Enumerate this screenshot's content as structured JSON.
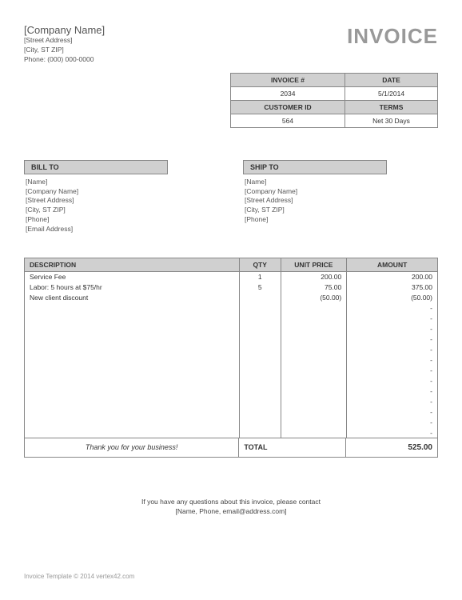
{
  "company": {
    "name": "[Company Name]",
    "street": "[Street Address]",
    "city": "[City, ST  ZIP]",
    "phone": "Phone: (000) 000-0000"
  },
  "title": "INVOICE",
  "meta": {
    "invoice_h": "INVOICE #",
    "invoice_v": "2034",
    "date_h": "DATE",
    "date_v": "5/1/2014",
    "cust_h": "CUSTOMER ID",
    "cust_v": "564",
    "terms_h": "TERMS",
    "terms_v": "Net 30 Days"
  },
  "billto": {
    "h": "BILL TO",
    "lines": [
      "[Name]",
      "[Company Name]",
      "[Street Address]",
      "[City, ST  ZIP]",
      "[Phone]",
      "[Email Address]"
    ]
  },
  "shipto": {
    "h": "SHIP TO",
    "lines": [
      "[Name]",
      "[Company Name]",
      "[Street Address]",
      "[City, ST  ZIP]",
      "[Phone]"
    ]
  },
  "cols": {
    "desc": "DESCRIPTION",
    "qty": "QTY",
    "up": "UNIT PRICE",
    "amt": "AMOUNT"
  },
  "rows": [
    {
      "desc": "Service Fee",
      "qty": "1",
      "up": "200.00",
      "amt": "200.00"
    },
    {
      "desc": "Labor: 5 hours at $75/hr",
      "qty": "5",
      "up": "75.00",
      "amt": "375.00"
    },
    {
      "desc": "New client discount",
      "qty": "",
      "up": "(50.00)",
      "amt": "(50.00)"
    },
    {
      "desc": "",
      "qty": "",
      "up": "",
      "amt": "-"
    },
    {
      "desc": "",
      "qty": "",
      "up": "",
      "amt": "-"
    },
    {
      "desc": "",
      "qty": "",
      "up": "",
      "amt": "-"
    },
    {
      "desc": "",
      "qty": "",
      "up": "",
      "amt": "-"
    },
    {
      "desc": "",
      "qty": "",
      "up": "",
      "amt": "-"
    },
    {
      "desc": "",
      "qty": "",
      "up": "",
      "amt": "-"
    },
    {
      "desc": "",
      "qty": "",
      "up": "",
      "amt": "-"
    },
    {
      "desc": "",
      "qty": "",
      "up": "",
      "amt": "-"
    },
    {
      "desc": "",
      "qty": "",
      "up": "",
      "amt": "-"
    },
    {
      "desc": "",
      "qty": "",
      "up": "",
      "amt": "-"
    },
    {
      "desc": "",
      "qty": "",
      "up": "",
      "amt": "-"
    },
    {
      "desc": "",
      "qty": "",
      "up": "",
      "amt": "-"
    },
    {
      "desc": "",
      "qty": "",
      "up": "",
      "amt": "-"
    }
  ],
  "thanks": "Thank you for your business!",
  "total_lbl": "TOTAL",
  "total_val": "525.00",
  "footer1": "If you have any questions about this invoice, please contact",
  "footer2": "[Name, Phone, email@address.com]",
  "copy": "Invoice Template © 2014 vertex42.com"
}
